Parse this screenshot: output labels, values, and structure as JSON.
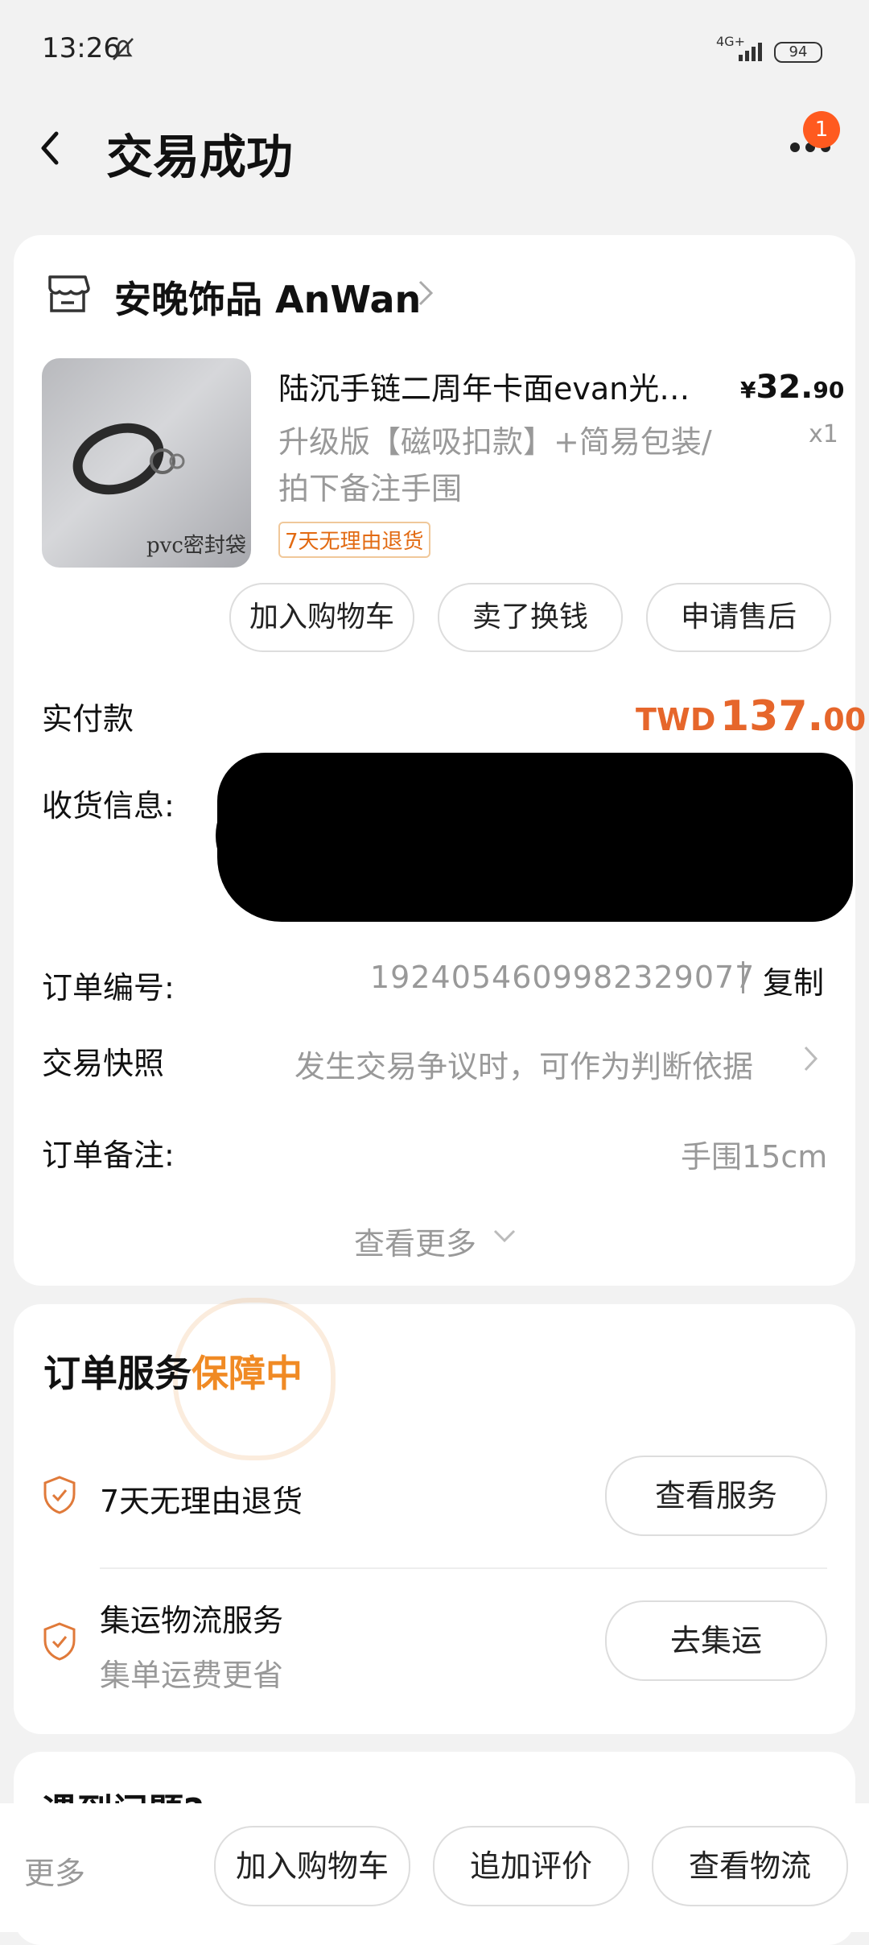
{
  "status_bar": {
    "time": "13:26",
    "network": "4G+",
    "battery": "94"
  },
  "header": {
    "title": "交易成功",
    "notification_count": "1"
  },
  "store": {
    "name": "安晚饰品 AnWan"
  },
  "product": {
    "title": "陆沉手链二周年卡面evan光…",
    "price_symbol": "¥",
    "price_int": "32.",
    "price_dec": "90",
    "sku": "升级版【磁吸扣款】+简易包装/拍下备注手围",
    "qty": "x1",
    "return_tag": "7天无理由退货",
    "thumb_caption": "pvc密封袋"
  },
  "item_actions": [
    "加入购物车",
    "卖了换钱",
    "申请售后"
  ],
  "order": {
    "paid_label": "实付款",
    "paid_currency": "TWD",
    "paid_int": "137.",
    "paid_dec": "00",
    "shipping_label": "收货信息:",
    "order_no_label": "订单编号:",
    "order_no": "1924054609982329077",
    "copy_label": "复制",
    "snapshot_label": "交易快照",
    "snapshot_value": "发生交易争议时，可作为判断依据",
    "note_label": "订单备注:",
    "note_value": "手围15cm",
    "see_more": "查看更多"
  },
  "services": {
    "title_prefix": "订单服务",
    "title_highlight": "保障中",
    "items": [
      {
        "name": "7天无理由退货",
        "sub": "",
        "button": "查看服务"
      },
      {
        "name": "集运物流服务",
        "sub": "集单运费更省",
        "button": "去集运"
      }
    ]
  },
  "problem_section": {
    "title": "遇到问题?"
  },
  "bottom_bar": {
    "more": "更多",
    "buttons": [
      "加入购物车",
      "追加评价",
      "查看物流"
    ]
  }
}
